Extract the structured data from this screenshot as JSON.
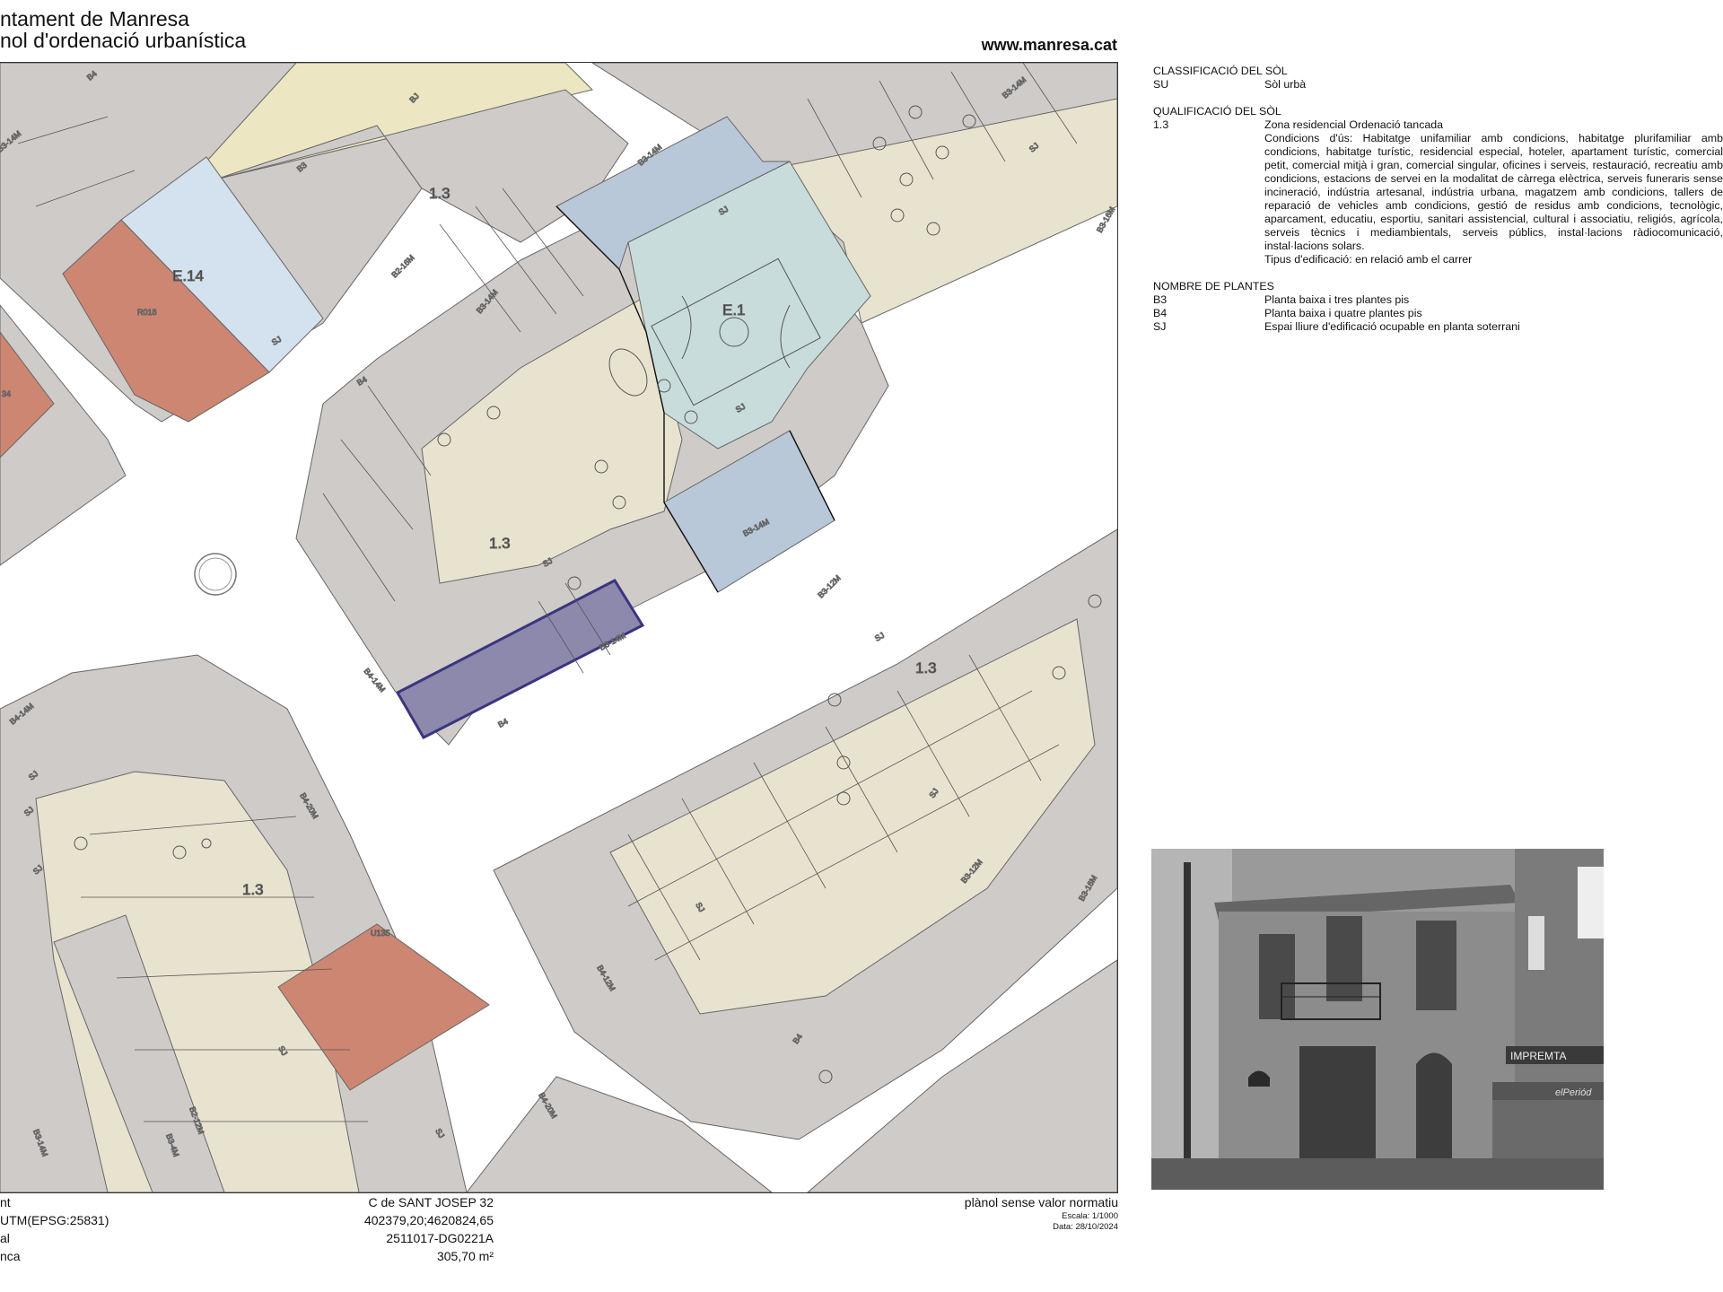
{
  "header": {
    "title": "ntament de Manresa",
    "subtitle": "nol d'ordenació urbanística",
    "url": "www.manresa.cat"
  },
  "map": {
    "zone_labels": [
      "1.3",
      "1.3",
      "1.3",
      "1.3"
    ],
    "equip_labels": [
      "E.14",
      "E.1"
    ],
    "parcel_codes": [
      "R018",
      "U135",
      "34"
    ],
    "small_labels": [
      "B3-14M",
      "B3-14M",
      "B3-14M",
      "B3-14M",
      "B3-12M",
      "B3-12M",
      "B3-16M",
      "B3-16M",
      "B2-16M",
      "B2-12M",
      "B3-14M",
      "B3-4M",
      "B4-14M",
      "B4-14M",
      "B4-12M",
      "B4-20M",
      "B4-20M",
      "B4",
      "B4",
      "B4",
      "B3",
      "B4",
      "SJ",
      "SJ",
      "SJ",
      "SJ",
      "SJ",
      "SJ",
      "SJ",
      "SJ",
      "SJ",
      "SJ",
      "SJ",
      "SJ",
      "BJ",
      "SJ",
      "B3-14M",
      "B3-14M"
    ]
  },
  "legend": {
    "classificacio": {
      "heading": "CLASSIFICACIÓ DEL SÒL",
      "code": "SU",
      "text": "Sòl urbà"
    },
    "qualificacio": {
      "heading": "QUALIFICACIÓ DEL SÒL",
      "code": "1.3",
      "name": "Zona residencial Ordenació tancada",
      "conditions": "Condicions d'ús: Habitatge unifamiliar amb condicions, habitatge plurifamiliar amb condicions, habitatge turístic, residencial especial, hoteler, apartament turístic, comercial petit, comercial mitjà i gran, comercial singular, oficines i serveis, restauració, recreatiu amb condicions, estacions de servei en la modalitat de càrrega elèctrica, serveis funeraris sense incineració, indústria artesanal, indústria urbana, magatzem amb condicions, tallers de reparació de vehicles amb condicions, gestió de residus amb condicions, tecnològic, aparcament, educatiu, esportiu, sanitari assistencial, cultural i associatiu, religiós, agrícola, serveis tècnics i mediambientals, serveis públics, instal·lacions ràdiocomunicació, instal·lacions solars.",
      "edificacio": "Tipus d'edificació: en relació amb el carrer"
    },
    "plantes": {
      "heading": "NOMBRE DE PLANTES",
      "rows": [
        {
          "code": "B3",
          "text": "Planta baixa i tres plantes pis"
        },
        {
          "code": "B4",
          "text": "Planta baixa i quatre plantes pis"
        },
        {
          "code": "SJ",
          "text": "Espai lliure d'edificació ocupable en planta soterrani"
        }
      ]
    }
  },
  "photo": {
    "sign_text": "IMPREMTA",
    "shop_text": "elPeriód"
  },
  "footer": {
    "left": [
      "nt",
      " UTM(EPSG:25831)",
      "al",
      "nca"
    ],
    "address": "C de SANT JOSEP 32",
    "coords": "402379,20;4620824,65",
    "cadastre": "2511017-DG0221A",
    "area": "305,70 m²",
    "disclaimer": "plànol sense valor normatiu",
    "scale": "Escala: 1/1000",
    "date": "Data: 28/10/2024"
  },
  "colors": {
    "residential": "#e8e3cf",
    "parcel": "#cfcbc9",
    "equip_light": "#d4e1ee",
    "equip_dark": "#b9c8d8",
    "equip_green": "#c9dcdc",
    "brick": "#cd8672",
    "selected": "#8c89ad",
    "road": "#ffffff"
  }
}
